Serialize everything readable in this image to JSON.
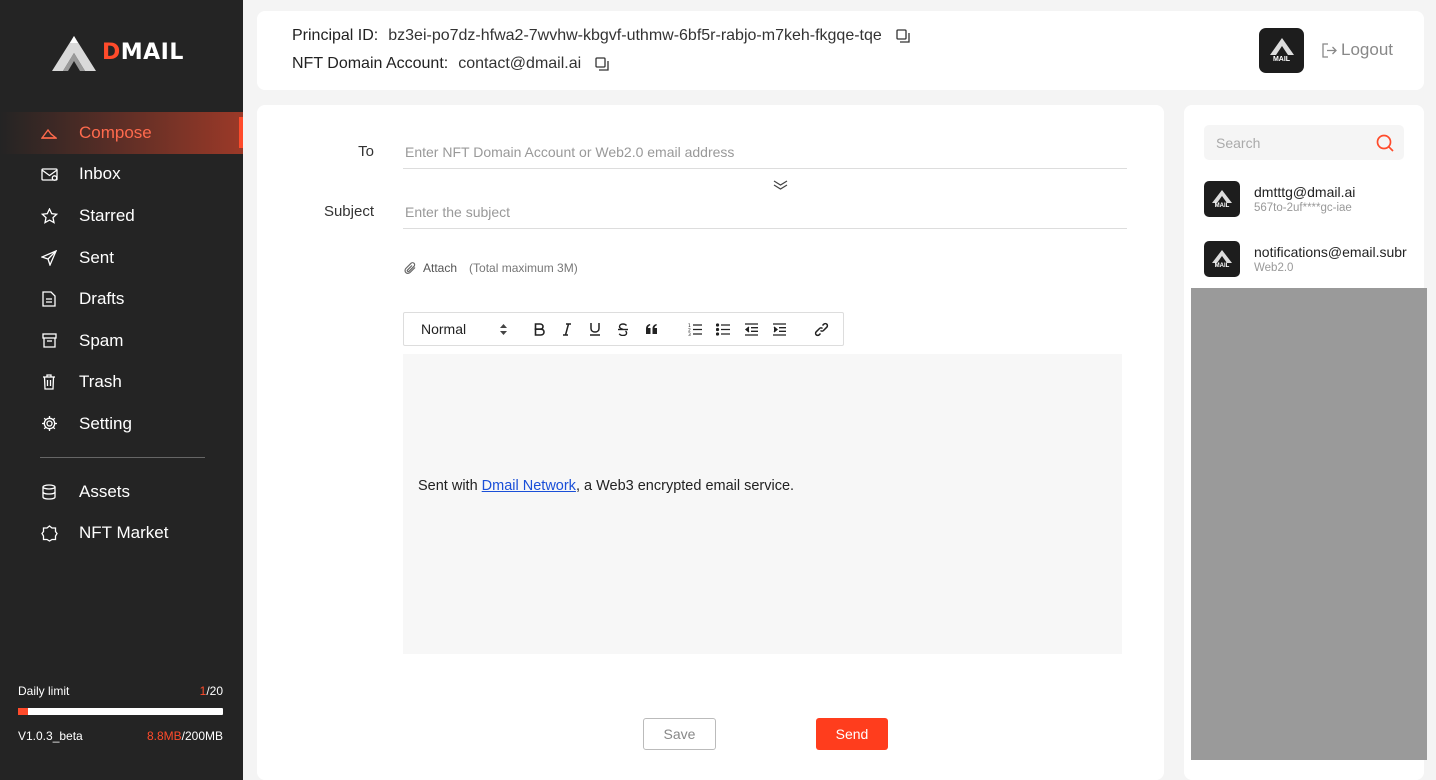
{
  "app": {
    "logo_text_accent": "D",
    "logo_text_rest": "MAIL",
    "brand_color": "#ff4b2b"
  },
  "sidebar": {
    "items": [
      {
        "label": "Compose",
        "icon": "compose-icon",
        "active": true
      },
      {
        "label": "Inbox",
        "icon": "inbox-icon"
      },
      {
        "label": "Starred",
        "icon": "star-icon"
      },
      {
        "label": "Sent",
        "icon": "send-icon"
      },
      {
        "label": "Drafts",
        "icon": "drafts-icon"
      },
      {
        "label": "Spam",
        "icon": "spam-icon"
      },
      {
        "label": "Trash",
        "icon": "trash-icon"
      },
      {
        "label": "Setting",
        "icon": "gear-icon"
      }
    ],
    "extra_items": [
      {
        "label": "Assets",
        "icon": "database-icon"
      },
      {
        "label": "NFT Market",
        "icon": "nft-market-icon"
      }
    ],
    "daily_limit_label": "Daily limit",
    "daily_limit_used": "1",
    "daily_limit_total": "/20",
    "daily_limit_fraction": 0.05,
    "version": "V1.0.3_beta",
    "storage_used": "8.8MB",
    "storage_total": "/200MB"
  },
  "header": {
    "principal_label": "Principal ID:",
    "principal_value": "bz3ei-po7dz-hfwa2-7wvhw-kbgvf-uthmw-6bf5r-rabjo-m7keh-fkgqe-tqe",
    "nft_label": "NFT Domain Account:",
    "nft_value": "contact@dmail.ai",
    "avatar_text": "MAIL",
    "logout_label": "Logout"
  },
  "compose": {
    "to_label": "To",
    "to_placeholder": "Enter NFT Domain Account or Web2.0 email address",
    "subject_label": "Subject",
    "subject_placeholder": "Enter the subject",
    "attach_label": "Attach",
    "attach_hint": "(Total maximum 3M)",
    "format_select": "Normal",
    "toolbar_buttons": [
      "bold",
      "italic",
      "underline",
      "strikethrough",
      "blockquote",
      "ordered-list",
      "bullet-list",
      "outdent",
      "indent",
      "link"
    ],
    "signature_prefix": "Sent with ",
    "signature_link": "Dmail Network",
    "signature_suffix": ", a Web3 encrypted email service.",
    "save_label": "Save",
    "send_label": "Send"
  },
  "contacts": {
    "search_placeholder": "Search",
    "items": [
      {
        "name": "dmtttg@dmail.ai",
        "sub": "567to-2uf****gc-iae"
      },
      {
        "name": "notifications@email.subr",
        "sub": "Web2.0"
      }
    ]
  }
}
